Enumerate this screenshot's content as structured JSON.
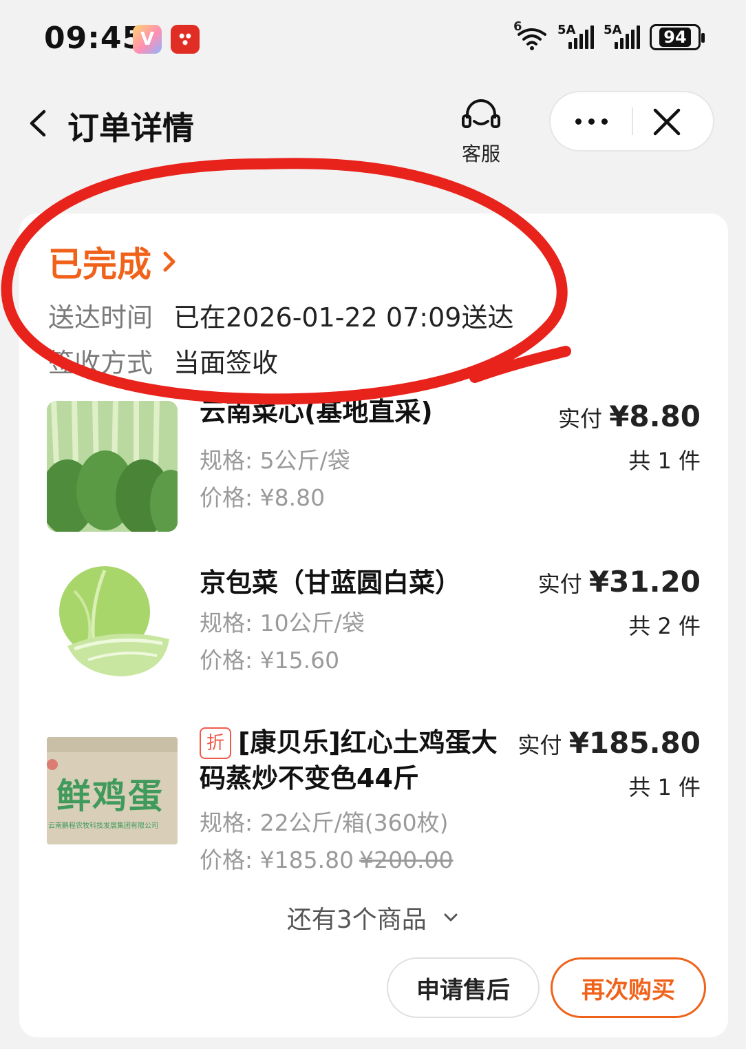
{
  "status_bar": {
    "time": "09:45",
    "wifi_tag": "6",
    "sim1_tag": "5A",
    "sim2_tag": "5A",
    "battery": "94"
  },
  "nav": {
    "title": "订单详情",
    "customer_service_label": "客服"
  },
  "order": {
    "status": "已完成",
    "delivery_time_label": "送达时间",
    "delivery_time_value": "已在2026-01-22 07:09送达",
    "sign_method_label": "签收方式",
    "sign_method_value": "当面签收"
  },
  "items": [
    {
      "name": "云南菜心(基地直采)",
      "spec": "规格: 5公斤/袋",
      "price": "价格: ¥8.80",
      "paid_label": "实付 ",
      "paid_amount": "¥8.80",
      "qty": "共 1 件"
    },
    {
      "name": "京包菜（甘蓝圆白菜）",
      "spec": "规格: 10公斤/袋",
      "price": "价格: ¥15.60",
      "paid_label": "实付 ",
      "paid_amount": "¥31.20",
      "qty": "共 2 件"
    },
    {
      "badge": "折",
      "name": "[康贝乐]红心土鸡蛋大码蒸炒不变色44斤",
      "spec": "规格: 22公斤/箱(360枚)",
      "price": "价格: ¥185.80",
      "original_price": "¥200.00",
      "paid_label": "实付 ",
      "paid_amount": "¥185.80",
      "qty": "共 1 件",
      "box_print": "鲜鸡蛋",
      "box_subprint": "云南鹏程农牧科技发展集团有限公司"
    }
  ],
  "more_items": "还有3个商品",
  "actions": {
    "after_sales": "申请售后",
    "buy_again": "再次购买"
  },
  "colors": {
    "accent": "#f0621a",
    "annotation": "#e8231c",
    "muted_text": "#9a9a9a"
  }
}
